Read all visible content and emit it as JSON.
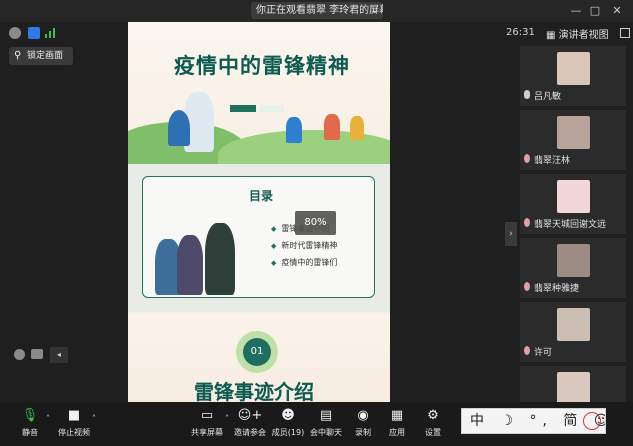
{
  "titlebar": {
    "sharing_text": "你正在观看翡翠 李玲君的屏幕",
    "minimize": "—",
    "maximize": "□",
    "close": "✕"
  },
  "topbar": {
    "time": "26:31",
    "view_label": "演讲者视图"
  },
  "lock_screen_label": "锁定画面",
  "slides": {
    "slide1_title": "疫情中的雷锋精神",
    "toc_title": "目录",
    "toc_items": [
      "雷锋事迹介绍",
      "新时代雷锋精神",
      "疫情中的雷锋们"
    ],
    "zoom_level": "80%",
    "section_number": "01",
    "section_title": "雷锋事迹介绍"
  },
  "participants": [
    {
      "name": "吕凡敏",
      "thumb_color": "#d9c6b8"
    },
    {
      "name": "翡翠汪林",
      "thumb_color": "#b7a39a"
    },
    {
      "name": "翡翠天城回谢文远",
      "thumb_color": "#f1d7d8"
    },
    {
      "name": "翡翠种雅捷",
      "thumb_color": "#9d8c84"
    },
    {
      "name": "许可",
      "thumb_color": "#cbbfb3"
    },
    {
      "name": "",
      "thumb_color": "#d8c8bd"
    }
  ],
  "toolbar": {
    "mute": "静音",
    "stop_video": "停止视频",
    "share_screen": "共享屏幕",
    "invite": "邀请参会",
    "members": "成员(19)",
    "chat": "会中聊天",
    "record": "录制",
    "apps": "应用",
    "settings": "设置"
  },
  "ime": {
    "text": "中 ☽ °, 简 ☺"
  }
}
